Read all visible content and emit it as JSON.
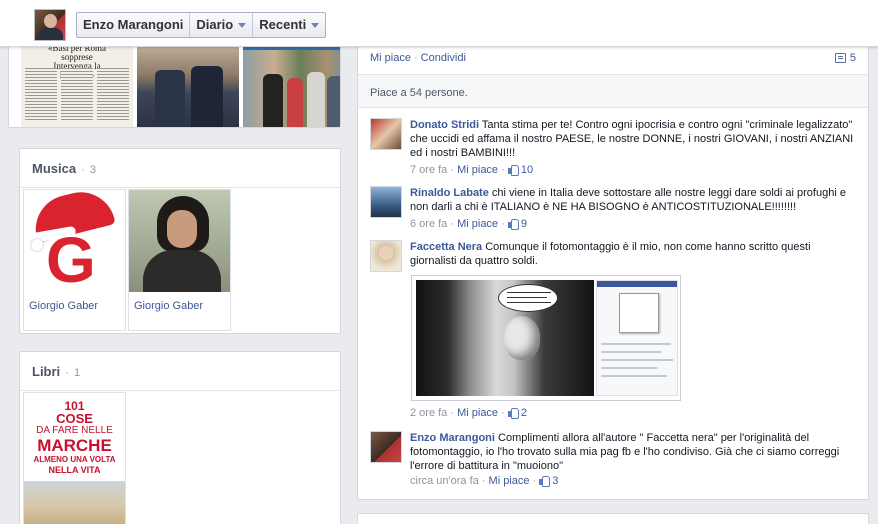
{
  "topbar": {
    "name": "Enzo Marangoni",
    "diario": "Diario",
    "recenti": "Recenti"
  },
  "newspaper": {
    "headline_line1": "«Basi per Roma sopprese",
    "headline_line2": "Intervenga la Regione»"
  },
  "musica": {
    "title": "Musica",
    "count": "3",
    "items": [
      {
        "label": "Giorgio Gaber"
      },
      {
        "label": "Giorgio Gaber"
      }
    ]
  },
  "libri": {
    "title": "Libri",
    "count": "1",
    "book": {
      "line1": "101",
      "line2": "COSE",
      "line3": "DA FARE NELLE",
      "line4": "MARCHE",
      "line5": "ALMENO UNA VOLTA",
      "line6": "NELLA VITA"
    }
  },
  "post": {
    "like_action": "Mi piace",
    "share_action": "Condividi",
    "separator": "·",
    "comment_count": "5",
    "likes_text": "Piace a 54 persone.",
    "comments": [
      {
        "author": "Donato Stridi",
        "text": "Tanta stima per te! Contro ogni ipocrisia e contro ogni \"criminale legalizzato\" che uccidi ed affama il nostro PAESE, le nostre DONNE, i nostri GIOVANI, i nostri ANZIANI ed i nostri BAMBINI!!!",
        "time": "7 ore fa",
        "like": "Mi piace",
        "likes": "10"
      },
      {
        "author": "Rinaldo Labate",
        "text": "chi viene in Italia deve sottostare alle nostre leggi dare soldi ai profughi e non darli a chi è ITALIANO è NE HA BISOGNO è ANTICOSTITUZIONALE!!!!!!!!",
        "time": "6 ore fa",
        "like": "Mi piace",
        "likes": "9"
      },
      {
        "author": "Faccetta Nera",
        "text": "Comunque il fotomontaggio è il mio, non come hanno scritto questi giornalisti da quattro soldi.",
        "time": "2 ore fa",
        "like": "Mi piace",
        "likes": "2"
      },
      {
        "author": "Enzo Marangoni",
        "text": "Complimenti allora all'autore \" Faccetta nera\" per l'originalità del fotomontaggio, io l'ho trovato sulla mia pag fb e l'ho condiviso. Già che ci siamo correggi l'errore di battitura in \"muoiono\"",
        "time": "circa un'ora fa",
        "like": "Mi piace",
        "likes": "3"
      }
    ]
  }
}
